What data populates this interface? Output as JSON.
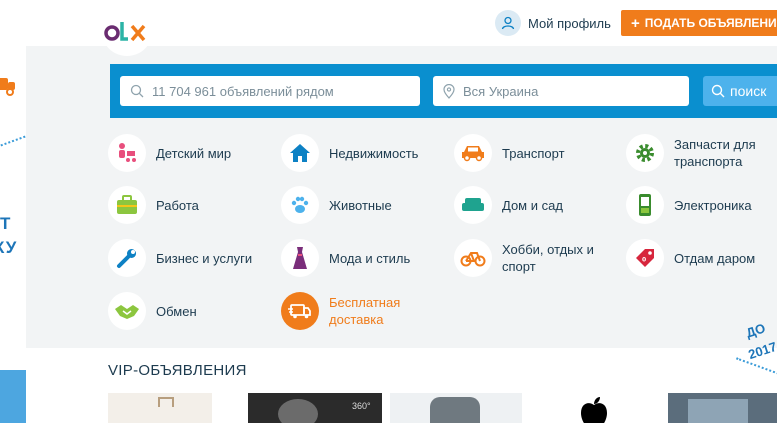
{
  "header": {
    "logo_text": "OLX",
    "profile_label": "Мой профиль",
    "post_ad_label": "ПОДАТЬ ОБЪЯВЛЕНИЕ",
    "post_ad_icon": "plus-icon"
  },
  "search": {
    "query_placeholder": "11 704 961 объявлений рядом",
    "location_placeholder": "Вся Украина",
    "button_label": "поиск"
  },
  "categories": [
    {
      "label": "Детский мир",
      "icon": "stroller-icon",
      "color": "#e84f7d"
    },
    {
      "label": "Недвижимость",
      "icon": "house-icon",
      "color": "#0d81c4"
    },
    {
      "label": "Транспорт",
      "icon": "car-icon",
      "color": "#f07c1b"
    },
    {
      "label": "Запчасти для транспорта",
      "icon": "gear-icon",
      "color": "#3a8c2e"
    },
    {
      "label": "Работа",
      "icon": "briefcase-icon",
      "color": "#8cc63f"
    },
    {
      "label": "Животные",
      "icon": "paw-icon",
      "color": "#4db2ec"
    },
    {
      "label": "Дом и сад",
      "icon": "sofa-icon",
      "color": "#1fa38f"
    },
    {
      "label": "Электроника",
      "icon": "phone-icon",
      "color": "#3a8c2e"
    },
    {
      "label": "Бизнес и услуги",
      "icon": "wrench-icon",
      "color": "#0d81c4"
    },
    {
      "label": "Мода и стиль",
      "icon": "dress-icon",
      "color": "#7a2d7a"
    },
    {
      "label": "Хобби, отдых и спорт",
      "icon": "bicycle-icon",
      "color": "#f07c1b"
    },
    {
      "label": "Отдам даром",
      "icon": "tag-icon",
      "color": "#d7263d"
    },
    {
      "label": "Обмен",
      "icon": "handshake-icon",
      "color": "#8cc63f"
    },
    {
      "label": "Бесплатная доставка",
      "icon": "delivery-truck-icon",
      "color": "#f07c1b"
    }
  ],
  "vip": {
    "title": "VIP-ОБЪЯВЛЕНИЯ",
    "thumb_360_label": "360°"
  },
  "promo": {
    "left_line1": "Т",
    "left_line2": "КУ",
    "right_line1": "ДО",
    "right_line2": "2017"
  },
  "colors": {
    "accent_orange": "#f07c1b",
    "search_blue": "#0a8fcf",
    "search_button": "#4db2ec",
    "text_dark": "#1d3b4f"
  }
}
